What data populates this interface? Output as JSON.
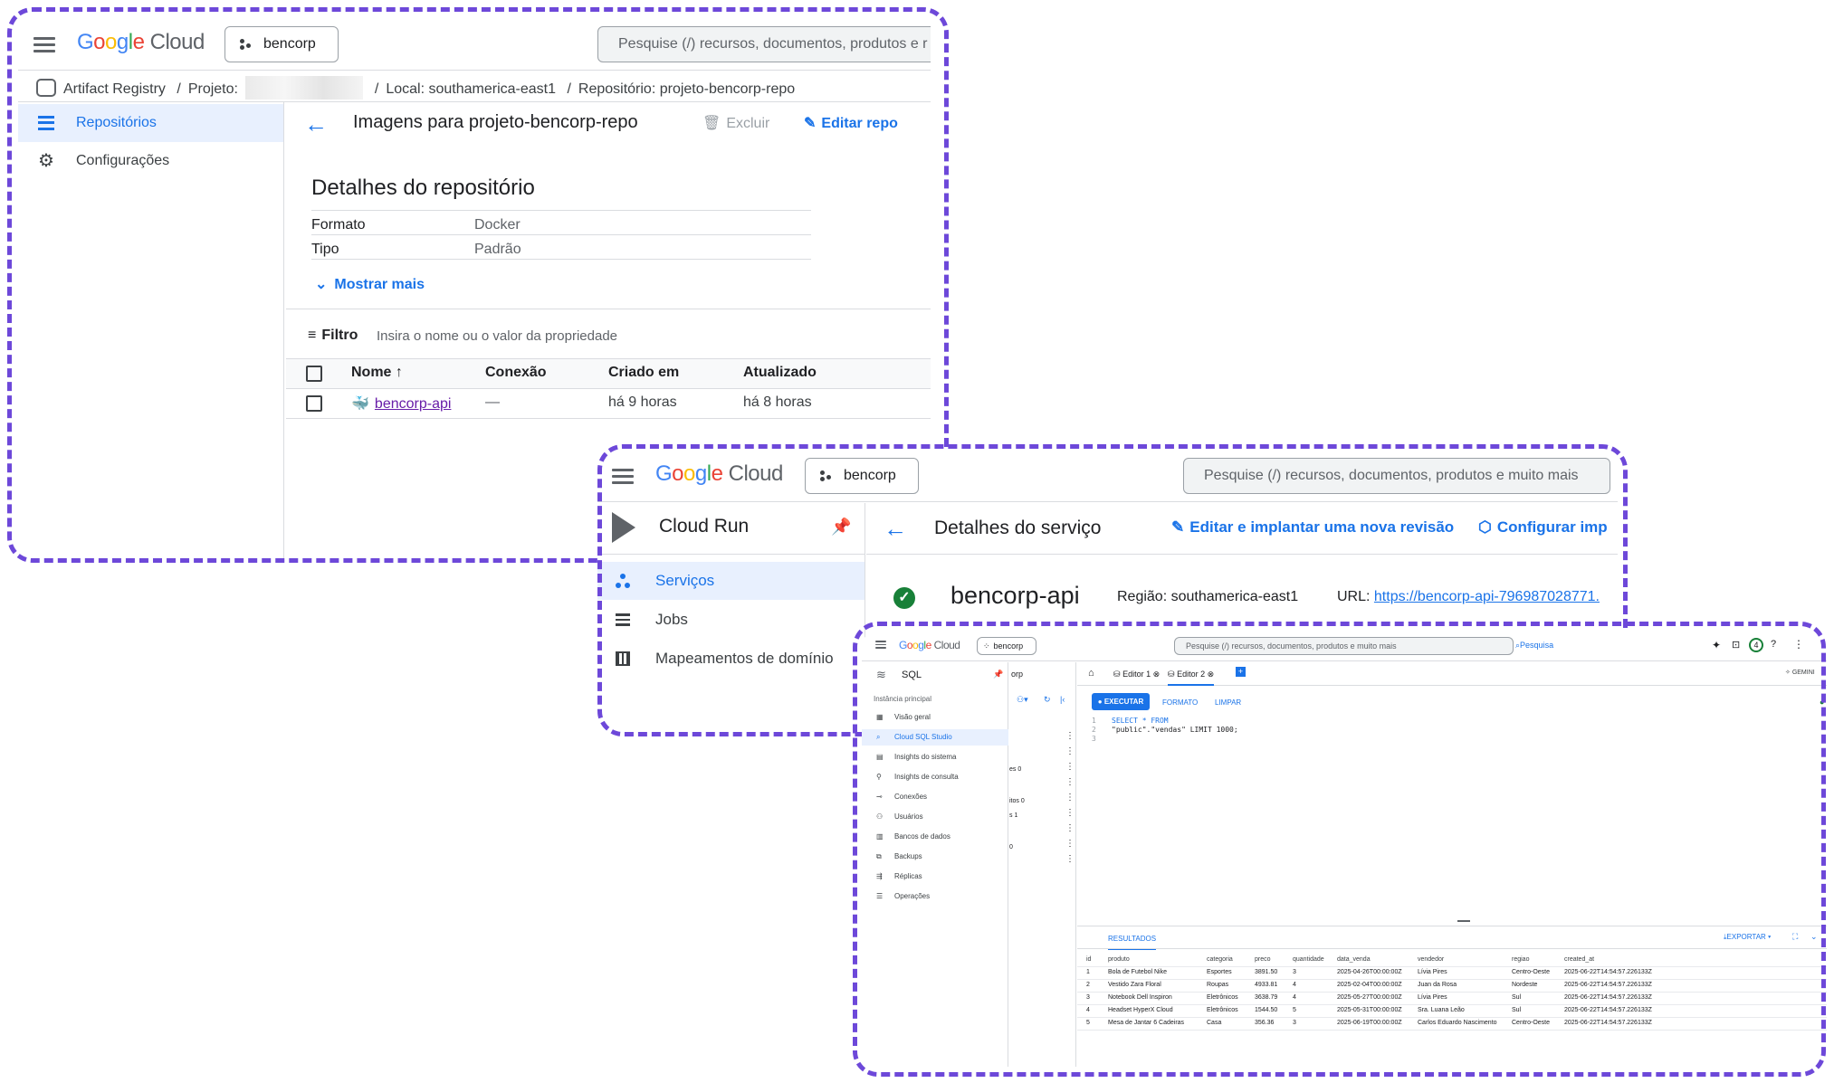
{
  "brand": {
    "logo_google": "Google",
    "logo_cloud": "Cloud"
  },
  "colors": {
    "accent": "#1a73e8",
    "outline": "#6d48d9",
    "success": "#188038"
  },
  "ar": {
    "project_chip": "bencorp",
    "search_placeholder": "Pesquise (/) recursos, documentos, produtos e r",
    "breadcrumb": {
      "service": "Artifact Registry",
      "sep": "/",
      "project_label": "Projeto:",
      "location": "Local: southamerica-east1",
      "repo": "Repositório: projeto-bencorp-repo"
    },
    "nav": [
      {
        "label": "Repositórios",
        "icon": "list-icon"
      },
      {
        "label": "Configurações",
        "icon": "gear-icon"
      }
    ],
    "title": "Imagens para projeto-bencorp-repo",
    "delete_label": "Excluir",
    "edit_label": "Editar repo",
    "details_title": "Detalhes do repositório",
    "details": [
      {
        "key": "Formato",
        "value": "Docker"
      },
      {
        "key": "Tipo",
        "value": "Padrão"
      }
    ],
    "show_more": "Mostrar mais",
    "filter_label": "Filtro",
    "filter_placeholder": "Insira o nome ou o valor da propriedade",
    "columns": [
      "Nome",
      "Conexão",
      "Criado em",
      "Atualizado"
    ],
    "rows": [
      {
        "name": "bencorp-api",
        "connection": "—",
        "created": "há 9 horas",
        "updated": "há 8 horas"
      }
    ]
  },
  "cr": {
    "project_chip": "bencorp",
    "search_placeholder": "Pesquise (/) recursos, documentos, produtos e muito mais",
    "product": "Cloud Run",
    "nav": [
      {
        "label": "Serviços",
        "icon": "services-icon"
      },
      {
        "label": "Jobs",
        "icon": "list-icon"
      },
      {
        "label": "Mapeamentos de domínio",
        "icon": "domain-grid-icon"
      }
    ],
    "title": "Detalhes do serviço",
    "edit_label": "Editar e implantar uma nova revisão",
    "config_label": "Configurar imp",
    "service_name": "bencorp-api",
    "region": "Região: southamerica-east1",
    "url_label": "URL:",
    "url": "https://bencorp-api-796987028771."
  },
  "sql": {
    "project_chip": "bencorp",
    "search_placeholder": "Pesquise (/) recursos, documentos, produtos e muito mais",
    "search_btn": "Pesquisa",
    "product": "SQL",
    "crumb_fragment": "orp",
    "instance_label": "Instância principal",
    "nav": [
      "Visão geral",
      "Cloud SQL Studio",
      "Insights do sistema",
      "Insights de consulta",
      "Conexões",
      "Usuários",
      "Bancos de dados",
      "Backups",
      "Réplicas",
      "Operações"
    ],
    "mid_fragments": [
      "es 0",
      "itos 0",
      "s 1",
      "0"
    ],
    "tabs": [
      "Editor 1",
      "Editor 2"
    ],
    "gemini": "GEMINI",
    "run_btn": "EXECUTAR",
    "format_btn": "FORMATO",
    "clear_btn": "LIMPAR",
    "code": [
      {
        "n": "1",
        "text": "SELECT * FROM"
      },
      {
        "n": "2",
        "text": "\"public\".\"vendas\" LIMIT 1000;"
      },
      {
        "n": "3",
        "text": ""
      }
    ],
    "results_tab": "RESULTADOS",
    "export_btn": "EXPORTAR",
    "columns": [
      "id",
      "produto",
      "categoria",
      "preco",
      "quantidade",
      "data_venda",
      "vendedor",
      "regiao",
      "created_at"
    ],
    "rows": [
      [
        "1",
        "Bola de Futebol Nike",
        "Esportes",
        "3891.50",
        "3",
        "2025-04-26T00:00:00Z",
        "Lívia Pires",
        "Centro-Oeste",
        "2025-06-22T14:54:57.226133Z"
      ],
      [
        "2",
        "Vestido Zara Floral",
        "Roupas",
        "4933.81",
        "4",
        "2025-02-04T00:00:00Z",
        "Juan da Rosa",
        "Nordeste",
        "2025-06-22T14:54:57.226133Z"
      ],
      [
        "3",
        "Notebook Dell Inspiron",
        "Eletrônicos",
        "3638.79",
        "4",
        "2025-05-27T00:00:00Z",
        "Lívia Pires",
        "Sul",
        "2025-06-22T14:54:57.226133Z"
      ],
      [
        "4",
        "Headset HyperX Cloud",
        "Eletrônicos",
        "1544.50",
        "5",
        "2025-05-31T00:00:00Z",
        "Sra. Luana Leão",
        "Sul",
        "2025-06-22T14:54:57.226133Z"
      ],
      [
        "5",
        "Mesa de Jantar 6 Cadeiras",
        "Casa",
        "356.36",
        "3",
        "2025-06-19T00:00:00Z",
        "Carlos Eduardo Nascimento",
        "Centro-Oeste",
        "2025-06-22T14:54:57.226133Z"
      ]
    ]
  }
}
